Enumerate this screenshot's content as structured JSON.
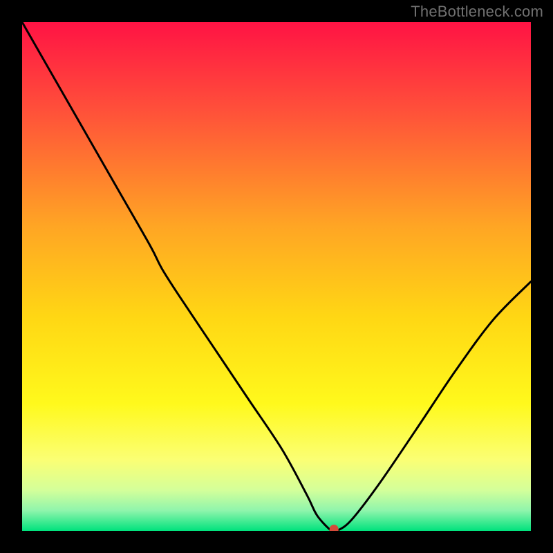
{
  "watermark": "TheBottleneck.com",
  "chart_data": {
    "type": "line",
    "title": "",
    "xlabel": "",
    "ylabel": "",
    "xlim": [
      0,
      100
    ],
    "ylim": [
      0,
      100
    ],
    "gradient_stops": [
      {
        "offset": 0.0,
        "color": "#ff1344"
      },
      {
        "offset": 0.17,
        "color": "#ff4f3a"
      },
      {
        "offset": 0.4,
        "color": "#ffa524"
      },
      {
        "offset": 0.58,
        "color": "#ffd714"
      },
      {
        "offset": 0.75,
        "color": "#fff91c"
      },
      {
        "offset": 0.86,
        "color": "#fbff74"
      },
      {
        "offset": 0.92,
        "color": "#d4ff9a"
      },
      {
        "offset": 0.96,
        "color": "#8ff5ac"
      },
      {
        "offset": 1.0,
        "color": "#00e27d"
      }
    ],
    "series": [
      {
        "name": "bottleneck-curve",
        "x": [
          0.0,
          6.3,
          12.6,
          18.9,
          25.2,
          27.5,
          31.0,
          37.7,
          44.4,
          51.1,
          56.0,
          58.0,
          60.8,
          61.8,
          64.6,
          70.0,
          77.5,
          85.2,
          92.6,
          100.0
        ],
        "y": [
          100.0,
          89.0,
          78.0,
          67.0,
          56.0,
          51.5,
          46.0,
          36.0,
          26.0,
          16.0,
          7.0,
          3.0,
          0.0,
          0.0,
          2.0,
          9.0,
          20.0,
          31.5,
          41.5,
          49.0
        ]
      }
    ],
    "marker": {
      "name": "optimum-point",
      "x": 61.3,
      "y": 0.0,
      "color": "#d44a3a"
    }
  }
}
